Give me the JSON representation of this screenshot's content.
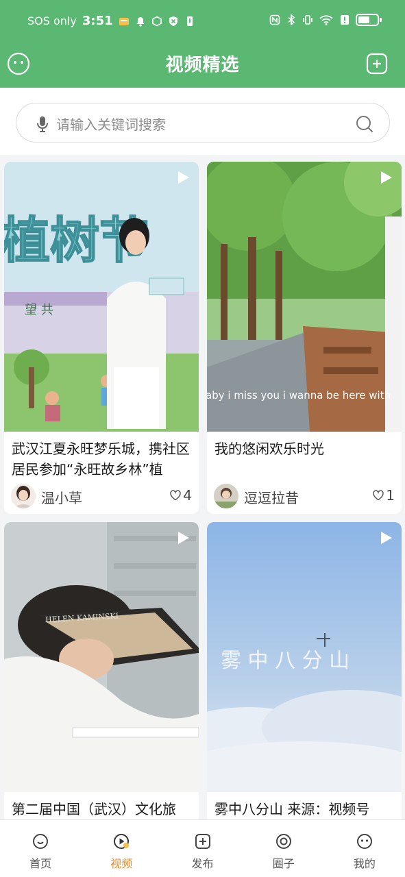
{
  "status_bar": {
    "carrier": "SOS only",
    "time": "3:51",
    "battery_level": 0.6
  },
  "header": {
    "title": "视频精选",
    "left_icon": "face-icon",
    "right_icon": "add-square-icon",
    "accent_color": "#5bb873"
  },
  "search": {
    "placeholder": "请输入关键词搜索"
  },
  "feed": {
    "cards": [
      {
        "title": "武汉江夏永旺梦乐城，携社区居民参加“永旺故乡林”植",
        "author": "温小草",
        "likes": "4",
        "thumb_text": "植树节",
        "thumb_sub": "望 共"
      },
      {
        "title": "我的悠闲欢乐时光",
        "author": "逗逗拉昔",
        "likes": "1",
        "thumb_caption": "aby i miss you i wanna be here with"
      },
      {
        "title": "第二届中国（武汉）文化旅",
        "author": "",
        "likes": "",
        "thumb_text": "HELEN KAMINSKI"
      },
      {
        "title": "雾中八分山 来源：视频号",
        "author": "",
        "likes": "",
        "thumb_text": "雾 中 八 分 山"
      }
    ]
  },
  "bottom_nav": {
    "active_color": "#e88a2e",
    "items": [
      {
        "label": "首页",
        "icon": "home-icon"
      },
      {
        "label": "视频",
        "icon": "video-play-icon"
      },
      {
        "label": "发布",
        "icon": "publish-icon"
      },
      {
        "label": "圈子",
        "icon": "circle-icon"
      },
      {
        "label": "我的",
        "icon": "profile-icon"
      }
    ]
  }
}
